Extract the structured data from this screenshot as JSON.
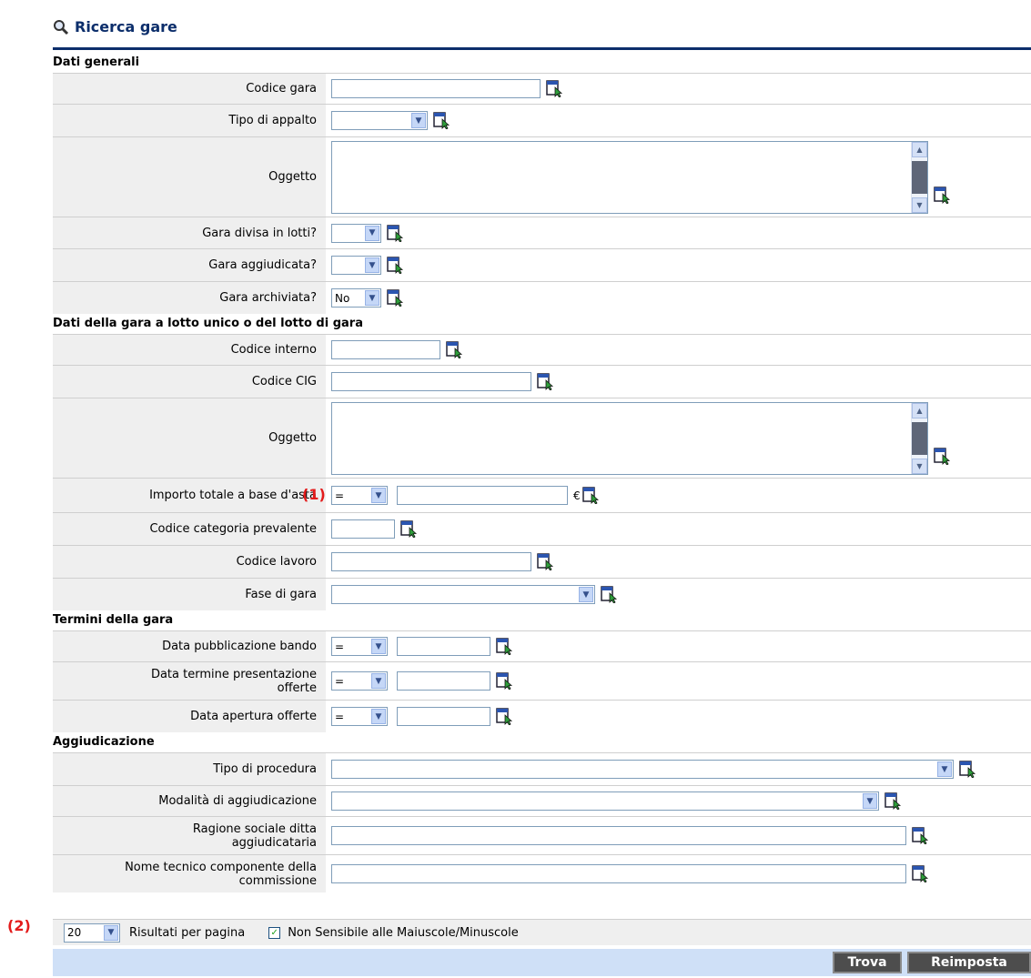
{
  "page": {
    "title": "Ricerca gare",
    "annotations": {
      "a1": "(1)",
      "a2": "(2)"
    }
  },
  "sections": {
    "dati_generali": "Dati generali",
    "dati_lotto": "Dati della gara a lotto unico o del lotto di gara",
    "termini": "Termini della gara",
    "aggiudicazione": "Aggiudicazione"
  },
  "fields": {
    "codice_gara": {
      "label": "Codice gara",
      "value": ""
    },
    "tipo_appalto": {
      "label": "Tipo di appalto",
      "value": ""
    },
    "oggetto1": {
      "label": "Oggetto",
      "value": ""
    },
    "gara_divisa": {
      "label": "Gara divisa in lotti?",
      "value": ""
    },
    "gara_aggiudicata": {
      "label": "Gara aggiudicata?",
      "value": ""
    },
    "gara_archiviata": {
      "label": "Gara archiviata?",
      "value": "No"
    },
    "codice_interno": {
      "label": "Codice interno",
      "value": ""
    },
    "codice_cig": {
      "label": "Codice CIG",
      "value": ""
    },
    "oggetto2": {
      "label": "Oggetto",
      "value": ""
    },
    "importo": {
      "label": "Importo totale a base d'asta",
      "operator": "=",
      "value": "",
      "currency": "€"
    },
    "codice_categoria": {
      "label": "Codice categoria prevalente",
      "value": ""
    },
    "codice_lavoro": {
      "label": "Codice lavoro",
      "value": ""
    },
    "fase_gara": {
      "label": "Fase di gara",
      "value": ""
    },
    "data_pubblicazione": {
      "label": "Data pubblicazione bando",
      "operator": "=",
      "value": ""
    },
    "data_termine": {
      "label": "Data termine presentazione offerte",
      "operator": "=",
      "value": ""
    },
    "data_apertura": {
      "label": "Data apertura offerte",
      "operator": "=",
      "value": ""
    },
    "tipo_procedura": {
      "label": "Tipo di procedura",
      "value": ""
    },
    "modalita": {
      "label": "Modalità di aggiudicazione",
      "value": ""
    },
    "ragione_sociale": {
      "label": "Ragione sociale ditta aggiudicataria",
      "value": ""
    },
    "nome_tecnico": {
      "label": "Nome tecnico componente della commissione",
      "value": ""
    }
  },
  "bottom": {
    "page_size": "20",
    "page_size_label": "Risultati per pagina",
    "case_insensitive_label": "Non Sensibile alle Maiuscole/Minuscole",
    "case_insensitive_checked": true
  },
  "buttons": {
    "trova": "Trova",
    "reimposta": "Reimposta"
  }
}
